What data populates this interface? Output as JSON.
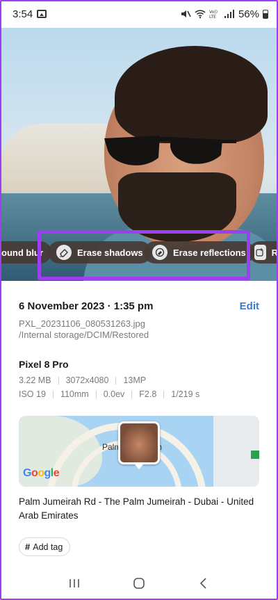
{
  "status_bar": {
    "time": "3:54",
    "battery": "56%"
  },
  "chips": {
    "blur_label": "ound blur",
    "shadows_label": "Erase shadows",
    "reflections_label": "Erase reflections",
    "more_label": "R"
  },
  "details": {
    "date": "6 November 2023 · 1:35 pm",
    "edit_label": "Edit",
    "filename": "PXL_20231106_080531263.jpg",
    "filepath": "/Internal storage/DCIM/Restored",
    "device": "Pixel 8 Pro",
    "meta_row1": [
      "3.22 MB",
      "3072x4080",
      "13MP"
    ],
    "meta_row2": [
      "ISO 19",
      "110mm",
      "0.0ev",
      "F2.8",
      "1/219 s"
    ],
    "map_label": "Palm",
    "map_label_suffix": "h",
    "map_brand": "Google",
    "address": "Palm Jumeirah Rd - The Palm Jumeirah - Dubai - United Arab Emirates",
    "add_tag_label": "Add tag"
  },
  "colors": {
    "accent_highlight": "#9b3ff0",
    "link_blue": "#3a78d8"
  }
}
